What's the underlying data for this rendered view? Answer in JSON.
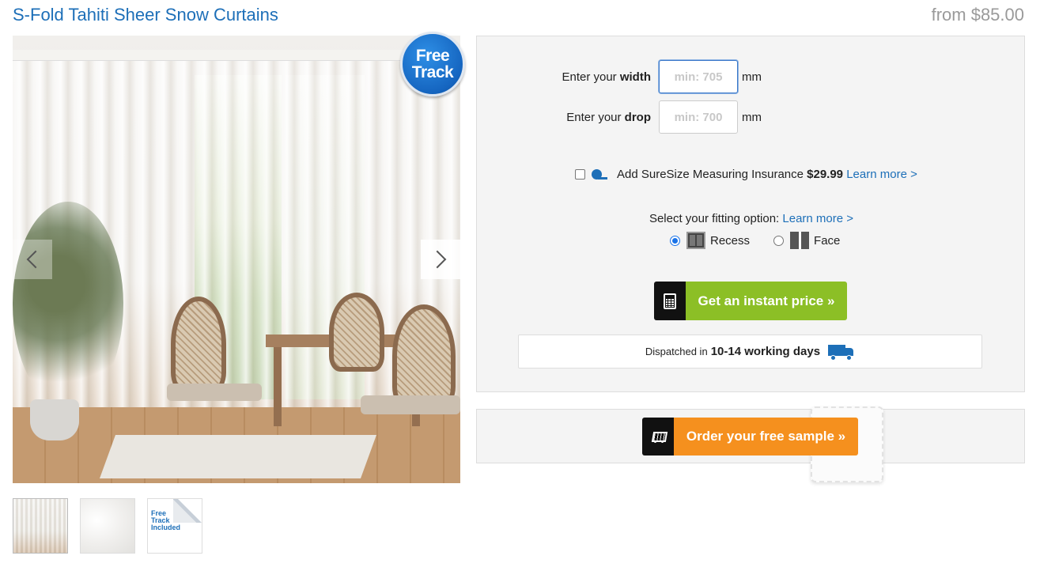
{
  "product": {
    "title": "S-Fold Tahiti Sheer Snow Curtains",
    "price": "from $85.00"
  },
  "gallery": {
    "badge_line1": "Free",
    "badge_line2": "Track",
    "prev_icon": "chevron-left-icon",
    "next_icon": "chevron-right-icon",
    "thumb3_line1": "Free",
    "thumb3_line2": "Track",
    "thumb3_line3": "Included"
  },
  "config": {
    "width": {
      "label_prefix": "Enter your",
      "label_bold": "width",
      "placeholder": "min: 705",
      "value": "",
      "unit": "mm"
    },
    "drop": {
      "label_prefix": "Enter your",
      "label_bold": "drop",
      "placeholder": "min: 700",
      "value": "",
      "unit": "mm"
    },
    "insurance": {
      "label": "Add SureSize Measuring Insurance",
      "price": "$29.99",
      "link": "Learn more >",
      "checked": false
    },
    "fitting": {
      "label": "Select your fitting option:",
      "link": "Learn more >",
      "options": [
        {
          "label": "Recess",
          "checked": true
        },
        {
          "label": "Face",
          "checked": false
        }
      ]
    },
    "price_button": "Get an instant price »",
    "dispatch": {
      "prefix": "Dispatched in",
      "duration": "10-14 working days"
    }
  },
  "sample": {
    "button": "Order your free sample »"
  },
  "colors": {
    "brand_blue": "#1d6fb8",
    "price_green": "#8cbf26",
    "sample_orange": "#f5901e"
  }
}
